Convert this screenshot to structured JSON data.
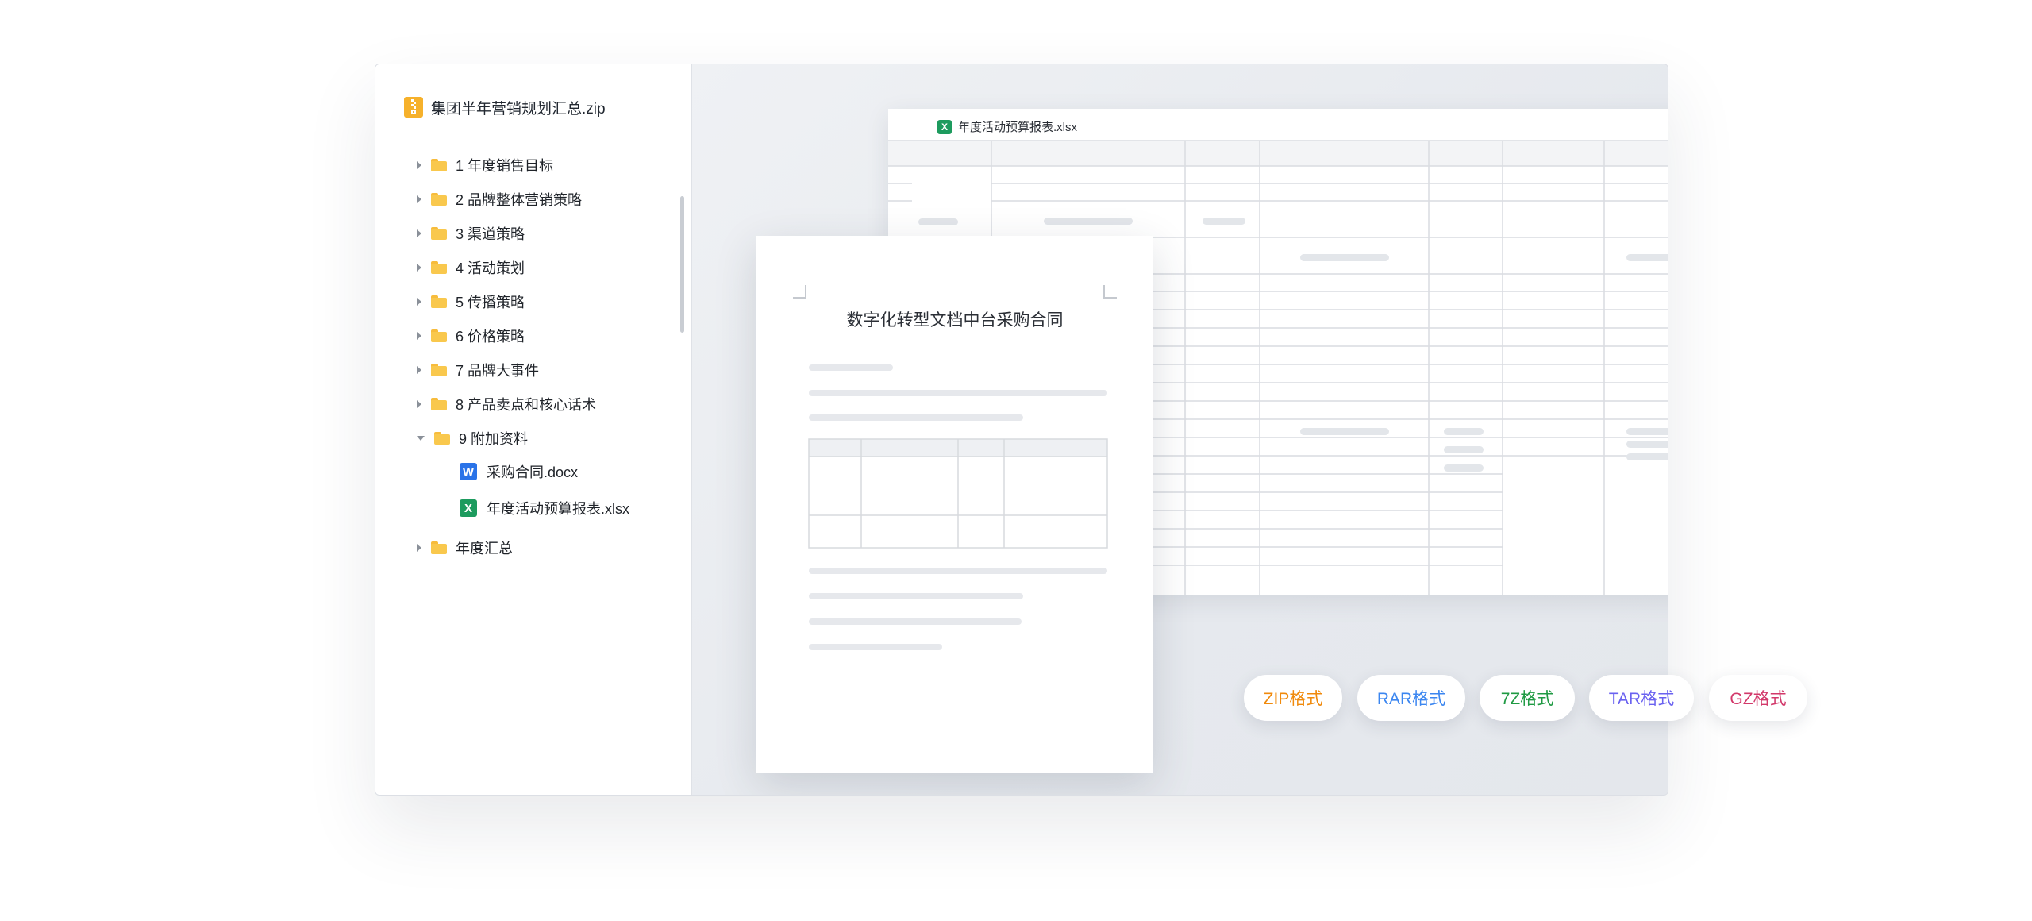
{
  "archive": {
    "name": "集团半年营销规划汇总.zip",
    "icon": "zip-archive-icon",
    "accent": "#f6b12b"
  },
  "tree": [
    {
      "label": "1 年度销售目标",
      "type": "folder",
      "expanded": false
    },
    {
      "label": "2 品牌整体营销策略",
      "type": "folder",
      "expanded": false
    },
    {
      "label": "3 渠道策略",
      "type": "folder",
      "expanded": false
    },
    {
      "label": "4 活动策划",
      "type": "folder",
      "expanded": false
    },
    {
      "label": "5 传播策略",
      "type": "folder",
      "expanded": false
    },
    {
      "label": "6 价格策略",
      "type": "folder",
      "expanded": false
    },
    {
      "label": "7 品牌大事件",
      "type": "folder",
      "expanded": false
    },
    {
      "label": "8 产品卖点和核心话术",
      "type": "folder",
      "expanded": false
    },
    {
      "label": "9 附加资料",
      "type": "folder",
      "expanded": true
    },
    {
      "label": "采购合同.docx",
      "type": "docx",
      "badge": "W"
    },
    {
      "label": "年度活动预算报表.xlsx",
      "type": "xlsx",
      "badge": "X"
    },
    {
      "label": "年度汇总",
      "type": "folder",
      "expanded": false
    }
  ],
  "spreadsheet_preview": {
    "title": "年度活动预算报表.xlsx",
    "badge": "X"
  },
  "document_preview": {
    "title": "数字化转型文档中台采购合同"
  },
  "formats": [
    {
      "label": "ZIP格式",
      "color": "#f08a0c"
    },
    {
      "label": "RAR格式",
      "color": "#3b86f0"
    },
    {
      "label": "7Z格式",
      "color": "#1f9a43"
    },
    {
      "label": "TAR格式",
      "color": "#6a62f0"
    },
    {
      "label": "GZ格式",
      "color": "#d2386a"
    }
  ]
}
